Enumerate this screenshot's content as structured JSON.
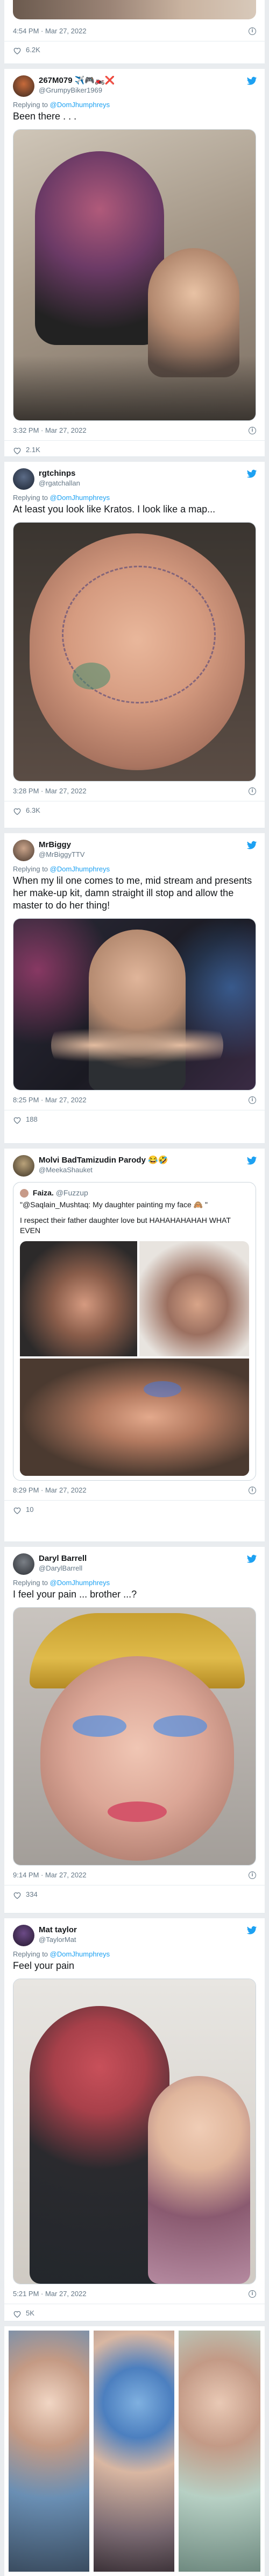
{
  "colors": {
    "accent": "#1da1f2",
    "muted": "#657786",
    "text": "#14171a",
    "heart": "#657786"
  },
  "icons": {
    "twitter": "twitter-bird-icon",
    "like": "heart-icon",
    "info": "info-icon"
  },
  "top_fragment": {
    "time": "4:54 PM · Mar 27, 2022",
    "likes": "6.2K"
  },
  "tweets": [
    {
      "display_name": "267M079 ✈️🎮🏍️❌",
      "handle": "@GrumpyBiker1969",
      "replying_label": "Replying to",
      "replying_to": "@DomJhumphreys",
      "text": "Been there . . .",
      "time": "3:32 PM · Mar 27, 2022",
      "likes": "2.1K"
    },
    {
      "display_name": "rgtchinps",
      "handle": "@rgatchallan",
      "replying_label": "Replying to",
      "replying_to": "@DomJhumphreys",
      "text": "At least you look like Kratos. I look like a map...",
      "time": "3:28 PM · Mar 27, 2022",
      "likes": "6.3K"
    },
    {
      "display_name": "MrBiggy",
      "handle": "@MrBiggyTTV",
      "replying_label": "Replying to",
      "replying_to": "@DomJhumphreys",
      "text": "When my lil one comes to me, mid stream and presents her make-up kit, damn straight ill stop and allow the master to do her thing!",
      "time": "8:25 PM · Mar 27, 2022",
      "likes": "188"
    },
    {
      "display_name": "Molvi BadTamizudin Parody 😂🤣",
      "handle": "@MeekaShauket",
      "quote_name": "Faiza.",
      "quote_handle": "@Fuzzup",
      "quote_line1": "\"@Saqlain_Mushtaq: My daughter painting my face 🙈 \"",
      "quote_line2": "I respect their father daughter love but HAHAHAHAHAH WHAT EVEN",
      "time": "8:29 PM · Mar 27, 2022",
      "likes": "10"
    },
    {
      "display_name": "Daryl Barrell",
      "handle": "@DarylBarrell",
      "replying_label": "Replying to",
      "replying_to": "@DomJhumphreys",
      "text": "I feel your pain ... brother ...?",
      "time": "9:14 PM · Mar 27, 2022",
      "likes": "334"
    },
    {
      "display_name": "Mat taylor",
      "handle": "@TaylorMat",
      "replying_label": "Replying to",
      "replying_to": "@DomJhumphreys",
      "text": "Feel your pain",
      "time": "5:21 PM · Mar 27, 2022",
      "likes": "5K"
    }
  ]
}
